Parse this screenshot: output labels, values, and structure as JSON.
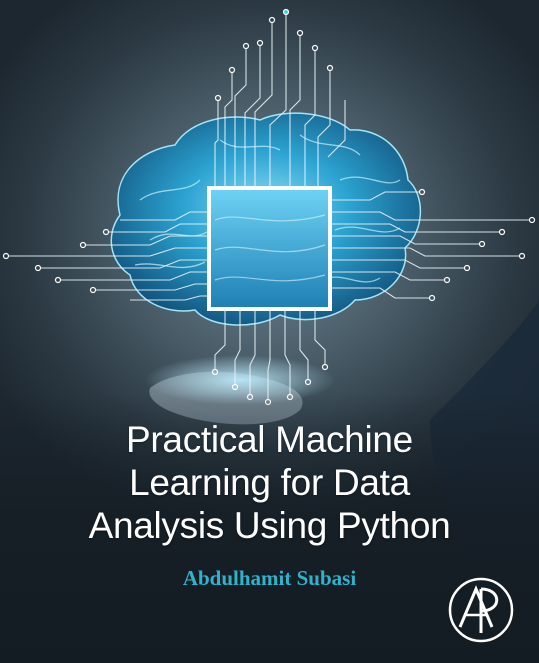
{
  "book": {
    "title_lines": [
      "Practical Machine",
      "Learning for Data",
      "Analysis Using Python"
    ],
    "author": "Abdulhamit Subasi",
    "publisher_logo": "elsevier-ap-monogram-icon"
  },
  "colors": {
    "title": "#ffffff",
    "author": "#2fb3cc",
    "brain": "#2aa6d6",
    "circuit": "#e6f2f7",
    "background": "#3f525d"
  }
}
